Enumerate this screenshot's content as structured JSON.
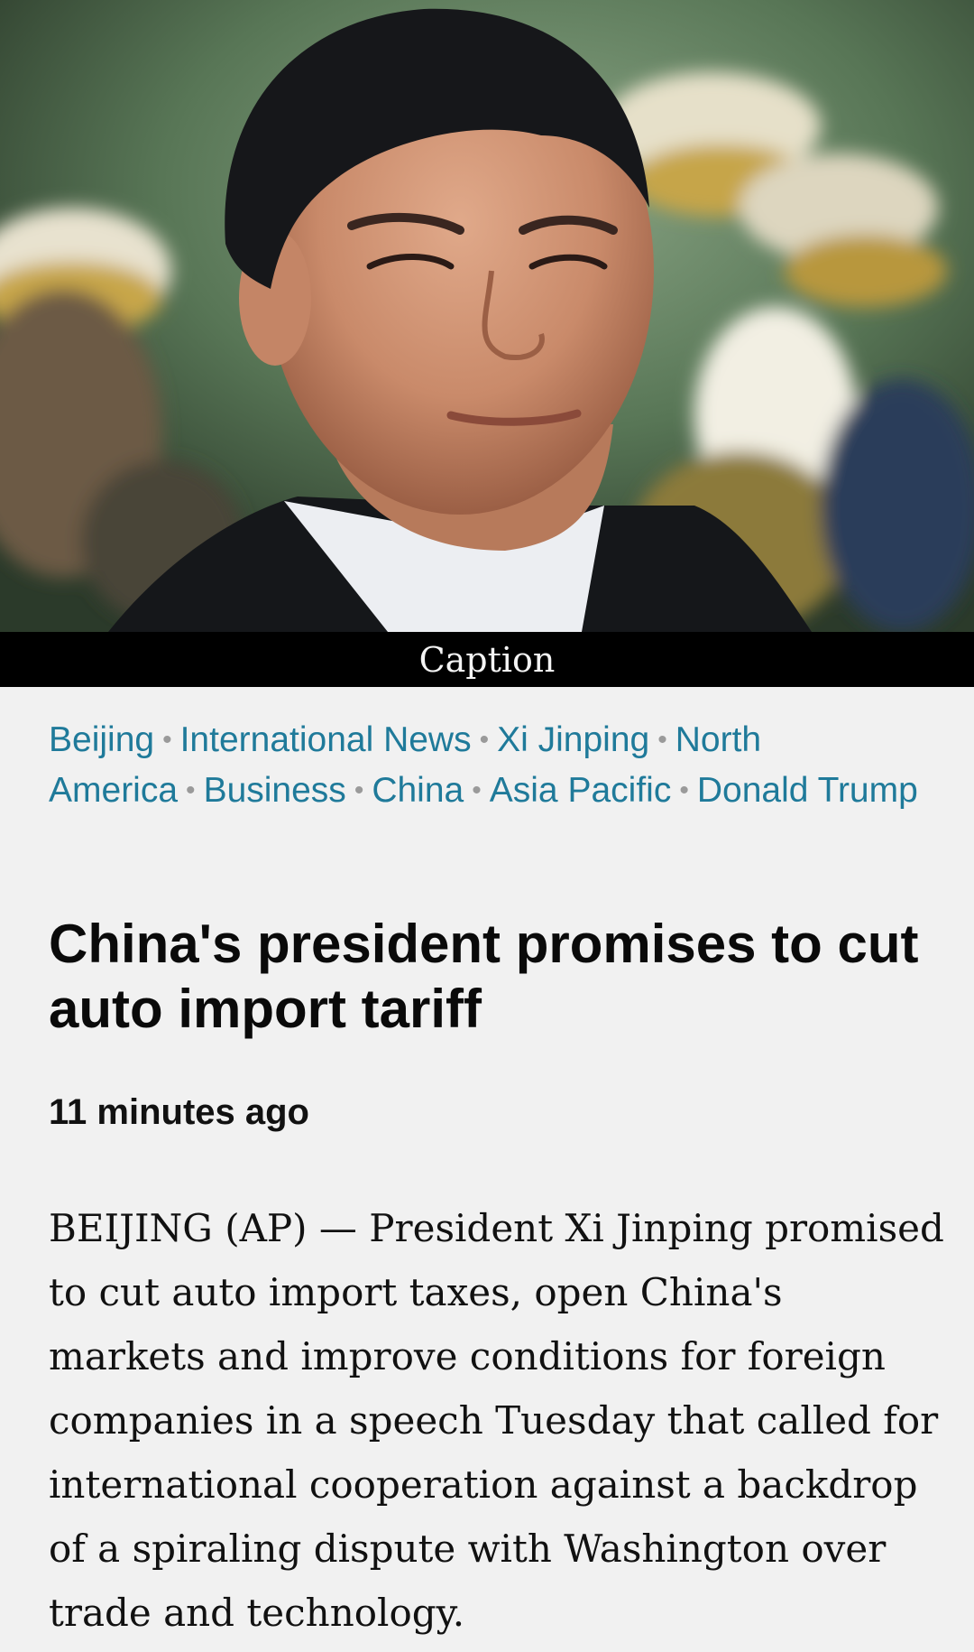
{
  "hero_image": {
    "alt": "Xi Jinping portrait photo",
    "caption": "Caption"
  },
  "tags": [
    "Beijing",
    "International News",
    "Xi Jinping",
    "North America",
    "Business",
    "China",
    "Asia Pacific",
    "Donald Trump"
  ],
  "article": {
    "headline": "China's president promises to cut auto import tariff",
    "timestamp": "11 minutes ago",
    "body": "BEIJING (AP) — President Xi Jinping promised to cut auto import taxes, open China's markets and improve conditions for foreign companies in a speech Tuesday that called for international cooperation against a backdrop of a spiraling dispute with Washington over trade and technology."
  },
  "colors": {
    "tag_link": "#1f7a9a",
    "background": "#f1f1f1",
    "caption_bar": "#000000"
  }
}
